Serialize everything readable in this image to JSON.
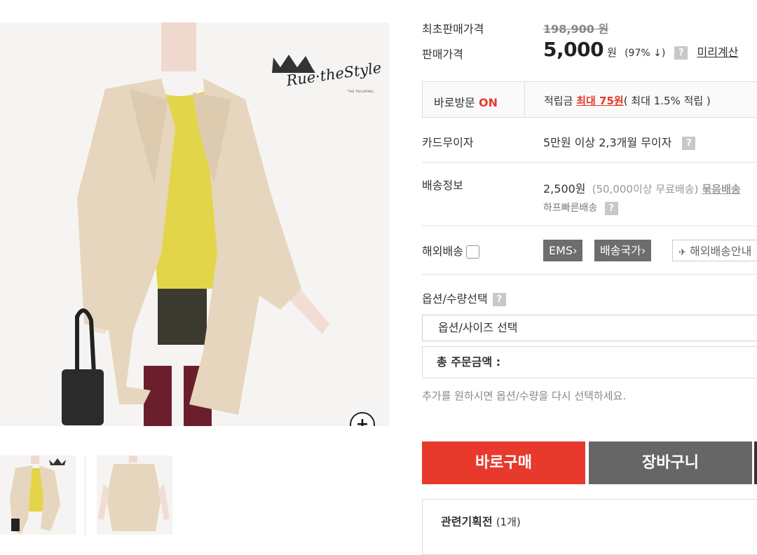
{
  "brand": {
    "name": "Rue·theStyle",
    "sub": "THE TAILORING"
  },
  "price": {
    "original_label": "최초판매가격",
    "original_value": "198,900 원",
    "sale_label": "판매가격",
    "sale_value": "5,000",
    "sale_unit": "원",
    "discount": "(97% ↓)",
    "qmark": "?",
    "precalc_link": "미리계산"
  },
  "visit": {
    "label": "바로방문",
    "status": "ON",
    "points_prefix": "적립금",
    "points_value": "최대 75원",
    "points_suffix": "( 최대 1.5% 적립 )"
  },
  "card": {
    "label": "카드무이자",
    "value": "5만원 이상 2,3개월 무이자"
  },
  "shipping": {
    "label": "배송정보",
    "fee": "2,500원",
    "free_note": "(50,000이상 무료배송)",
    "bundle_link": "묶음배송",
    "method": "하프빠른배송"
  },
  "overseas": {
    "label": "해외배송",
    "ems": "EMS›",
    "countries": "배송국가›",
    "guide": "해외배송안내"
  },
  "option": {
    "label": "옵션/수량선택",
    "select_placeholder": "옵션/사이즈 선택",
    "total_label": "총 주문금액 :",
    "note": "추가를 원하시면 옵션/수량을 다시 선택하세요."
  },
  "actions": {
    "buy": "바로구매",
    "cart": "장바구니"
  },
  "related": {
    "title": "관련기획전",
    "count": "(1개)"
  },
  "colors": {
    "accent": "#e73a2d",
    "cart": "#666666",
    "coat": "#e6d6bd",
    "sweater": "#e3d54a"
  },
  "icons": {
    "zoom": "zoom-in-icon",
    "help": "question-icon",
    "plane": "plane-icon"
  }
}
